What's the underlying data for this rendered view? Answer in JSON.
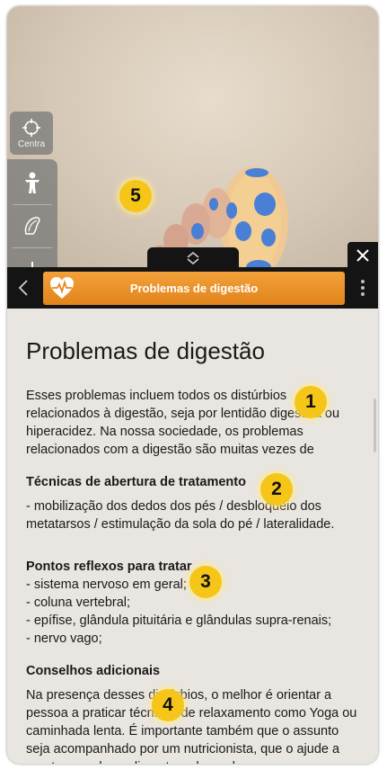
{
  "viewport": {
    "centra_label": "Centra",
    "icons": [
      "crosshair-icon",
      "body-icon",
      "muscle-icon",
      "bone-icon"
    ],
    "badges": [
      "1",
      "2",
      "3",
      "4",
      "5"
    ]
  },
  "header": {
    "title": "Problemas de digestão",
    "accent": "#f0972d"
  },
  "content": {
    "heading": "Problemas de digestão",
    "intro": "Esses problemas incluem todos os distúrbios relacionados à digestão, seja por lentidão digestiva ou hiperacidez. Na nossa sociedade, os problemas relacionados com a digestão são muitas vezes de",
    "sections": [
      {
        "title": "Técnicas de abertura de tratamento",
        "lines": [
          "- mobilização dos dedos dos pés / desbloqueio dos metatarsos / estimulação da sola do pé / lateralidade."
        ]
      },
      {
        "title": "Pontos reflexos para tratar",
        "lines": [
          "- sistema nervoso em geral;",
          "- coluna vertebral;",
          "- epífise, glândula pituitária e glândulas supra-renais;",
          "- nervo vago;"
        ]
      },
      {
        "title": "Conselhos adicionais",
        "lines": [
          "Na presença desses distúrbios, o melhor é orientar a pessoa a praticar técnicas de relaxamento como Yoga ou caminhada lenta. É importante também que o assunto seja acompanhado por um nutricionista, que o ajude a montar um plano alimentar adequado para"
        ]
      }
    ]
  }
}
